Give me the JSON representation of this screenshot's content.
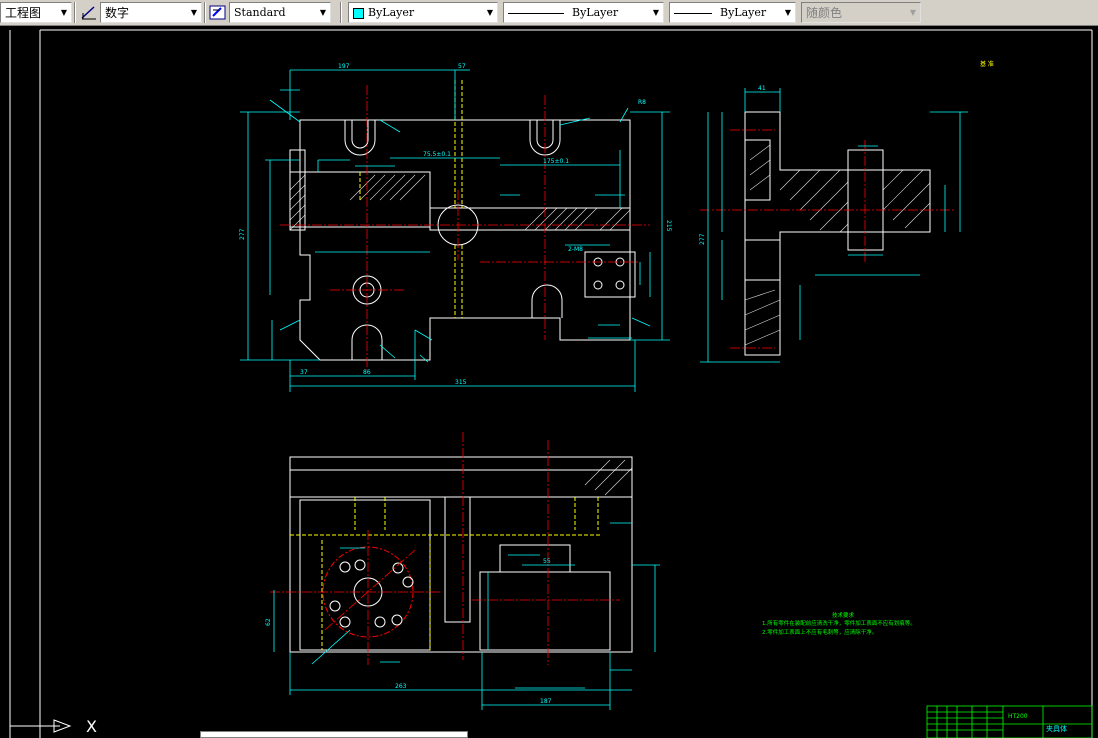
{
  "toolbar": {
    "style_combo": {
      "value": "工程图"
    },
    "dimstyle_combo": {
      "value": "数字"
    },
    "textstyle_combo": {
      "value": "Standard"
    },
    "layer_color_combo": {
      "value": "ByLayer",
      "swatch_color": "#00ffff"
    },
    "linetype_combo": {
      "value": "ByLayer"
    },
    "lineweight_combo": {
      "value": "ByLayer"
    },
    "plotstyle_combo": {
      "value": "随颜色"
    }
  },
  "drawing": {
    "background": "#000000",
    "colors": {
      "cyan": "#00ffff",
      "white": "#ffffff",
      "red": "#ff0000",
      "yellow": "#ffff00",
      "green": "#00ff00",
      "magenta": "#ff00ff"
    },
    "top_view_dims": {
      "width_total": "315",
      "width_top": "197",
      "width_right_top": "57",
      "height_total": "277",
      "height_right": "215",
      "bottom_left": "37",
      "bottom_mid": "86",
      "mid_dim_1": "75.5±0.1",
      "mid_dim_2": "175±0.1",
      "pitch_label": "2-M8",
      "r_label": "R8"
    },
    "side_view_dims": {
      "total_height": "277",
      "top_width": "41"
    },
    "front_view_dims": {
      "total_width": "263",
      "bottom_right": "187",
      "left_h": "62",
      "mid_h": "55"
    },
    "tech_notes": {
      "title": "技术要求",
      "line1": "1.所有零件在装配前应清洗干净，零件加工表面不应有划痕等。",
      "line2": "2.零件加工表面上不应有毛刺等，应清除干净。"
    },
    "title_block": {
      "material": "HT200",
      "name": "夹具体"
    },
    "ucs_label": "X",
    "corner_mark": "基 准"
  }
}
